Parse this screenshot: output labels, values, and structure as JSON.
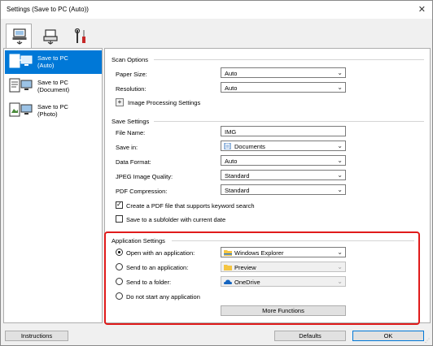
{
  "window": {
    "title": "Settings (Save to PC (Auto))"
  },
  "tabs": [
    {
      "icon": "scanner-from-pc-icon"
    },
    {
      "icon": "scanner-panel-icon"
    },
    {
      "icon": "tools-icon"
    }
  ],
  "sidebar": {
    "items": [
      {
        "line1": "Save to PC",
        "line2": "(Auto)",
        "active": true
      },
      {
        "line1": "Save to PC",
        "line2": "(Document)",
        "active": false
      },
      {
        "line1": "Save to PC",
        "line2": "(Photo)",
        "active": false
      }
    ]
  },
  "scan_options": {
    "title": "Scan Options",
    "paper_size_label": "Paper Size:",
    "paper_size_value": "Auto",
    "resolution_label": "Resolution:",
    "resolution_value": "Auto",
    "image_processing_label": "Image Processing Settings"
  },
  "save_settings": {
    "title": "Save Settings",
    "file_name_label": "File Name:",
    "file_name_value": "IMG",
    "save_in_label": "Save in:",
    "save_in_value": "Documents",
    "data_format_label": "Data Format:",
    "data_format_value": "Auto",
    "jpeg_quality_label": "JPEG Image Quality:",
    "jpeg_quality_value": "Standard",
    "pdf_compression_label": "PDF Compression:",
    "pdf_compression_value": "Standard",
    "keyword_pdf_label": "Create a PDF file that supports keyword search",
    "keyword_pdf_checked": true,
    "subfolder_label": "Save to a subfolder with current date",
    "subfolder_checked": false
  },
  "application_settings": {
    "title": "Application Settings",
    "open_app_label": "Open with an application:",
    "open_app_value": "Windows Explorer",
    "send_app_label": "Send to an application:",
    "send_app_value": "Preview",
    "send_folder_label": "Send to a folder:",
    "send_folder_value": "OneDrive",
    "no_app_label": "Do not start any application",
    "more_functions_label": "More Functions",
    "selected": "open_app"
  },
  "footer": {
    "instructions_label": "Instructions",
    "defaults_label": "Defaults",
    "ok_label": "OK"
  },
  "colors": {
    "accent": "#0078d7",
    "highlight": "#e01b1b"
  }
}
